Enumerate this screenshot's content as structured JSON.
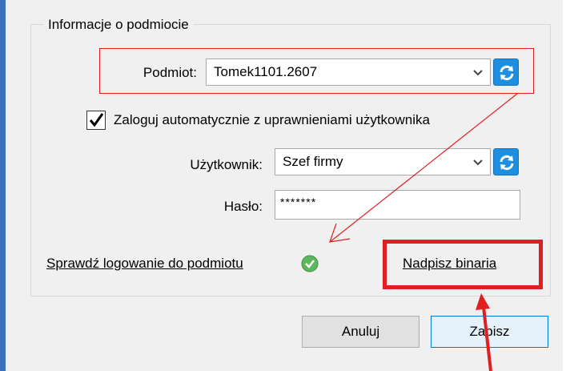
{
  "group": {
    "title": "Informacje o podmiocie"
  },
  "subject": {
    "label": "Podmiot:",
    "value": "Tomek1101.2607",
    "refresh_icon": "refresh-icon"
  },
  "auto_login": {
    "checked": true,
    "label": "Zaloguj automatycznie z uprawnieniami użytkownika"
  },
  "user": {
    "label": "Użytkownik:",
    "value": "Szef firmy",
    "refresh_icon": "refresh-icon"
  },
  "password": {
    "label": "Hasło:",
    "value": "*******"
  },
  "links": {
    "check_login": "Sprawdź logowanie do podmiotu",
    "overwrite_binaries": "Nadpisz binaria"
  },
  "buttons": {
    "cancel": "Anuluj",
    "save": "Zapisz"
  },
  "colors": {
    "accent_blue": "#1e8fe0",
    "annotation_red": "#e02020",
    "check_green": "#5cb85c"
  }
}
